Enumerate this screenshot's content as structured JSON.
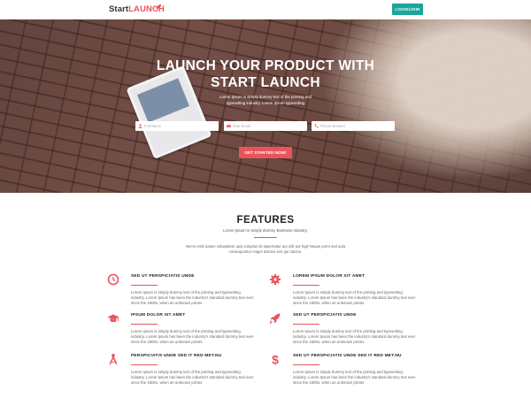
{
  "header": {
    "logo_start": "Start",
    "logo_launch": "LAUNCH",
    "login_label": "LOGIN/JOIN"
  },
  "hero": {
    "title_line1": "LAUNCH YOUR PRODUCT WITH",
    "title_line2": "START LAUNCH",
    "subtitle": "Lorem Ipsum is simply dummy text of the printing and typesetting industry. Lorem Ipsum typesetting",
    "full_name_placeholder": "Full Name",
    "email_placeholder": "Your Email",
    "phone_placeholder": "Phone Number",
    "cta_label": "GET STARTED NOW!"
  },
  "features": {
    "title": "FEATURES",
    "subtitle": "Lorem Ipsum is simply dummy Business industry.",
    "description": "Nemo enim ipsam voluptatem quia voluptas sit aspernatur aut odit aut fugit Neque porro sed quia consequuntur magni dolores eos qui ratione.",
    "items": [
      {
        "icon": "clock-icon",
        "title": "SED UT PERSPICIATIS UNDE",
        "body": "Lorem Ipsum is simply dummy text of the printing and typesetting industry. Lorem Ipsum has been the industry's standard dummy text ever since the 1500s, when an unknown printer."
      },
      {
        "icon": "gear-icon",
        "title": "LOREM IPSUM DOLOR SIT AMET",
        "body": "Lorem Ipsum is simply dummy text of the printing and typesetting industry. Lorem Ipsum has been the industry's standard dummy text ever since the 1500s, when an unknown printer."
      },
      {
        "icon": "graduation-cap-icon",
        "title": "IPSUM DOLOR SIT AMET",
        "body": "Lorem Ipsum is simply dummy text of the printing and typesetting industry. Lorem Ipsum has been the industry's standard dummy text ever since the 1500s, when an unknown printer."
      },
      {
        "icon": "rocket-icon",
        "title": "SED UT PERSPICIATIS UNDE",
        "body": "Lorem Ipsum is simply dummy text of the printing and typesetting industry. Lorem Ipsum has been the industry's standard dummy text ever since the 1500s, when an unknown printer."
      },
      {
        "icon": "compass-icon",
        "title": "PERSPICIATIS UNDE SED IT RED MET.NU",
        "body": "Lorem Ipsum is simply dummy text of the printing and typesetting industry. Lorem Ipsum has been the industry's standard dummy text ever since the 1500s, when an unknown printer."
      },
      {
        "icon": "dollar-icon",
        "title": "SED UT PERSPICIATIS UNDE SED IT RED MET.NU",
        "body": "Lorem Ipsum is simply dummy text of the printing and typesetting industry. Lorem Ipsum has been the industry's standard dummy text ever since the 1500s, when an unknown printer."
      }
    ]
  },
  "colors": {
    "accent": "#e9545b",
    "login_button": "#1aa69b"
  }
}
